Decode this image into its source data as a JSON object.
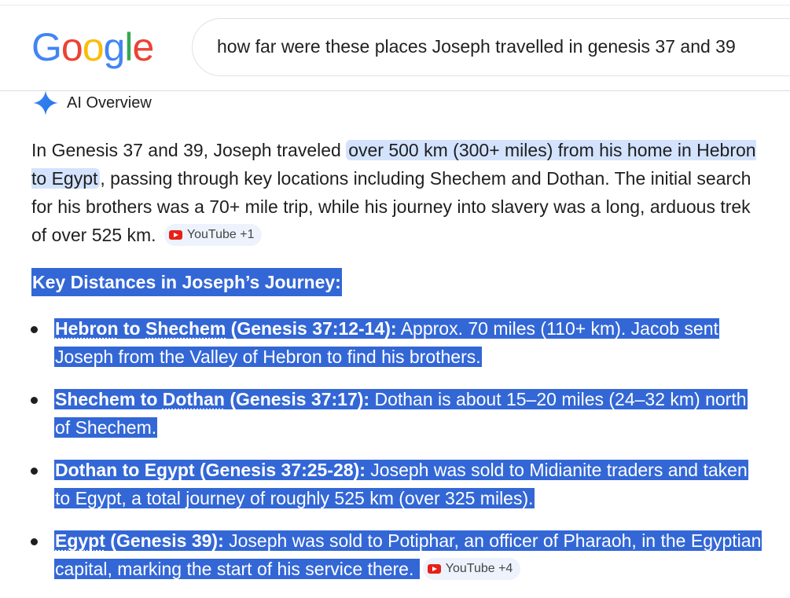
{
  "header": {
    "logo_text": "Google",
    "logo_colors": [
      "#4285F4",
      "#EA4335",
      "#FBBC05",
      "#4285F4",
      "#34A853",
      "#EA4335"
    ],
    "search_query": "how far were these places Joseph travelled in genesis 37 and 39"
  },
  "ai_overview": {
    "title": "AI Overview",
    "icon": "sparkle-icon",
    "intro": {
      "before": "In Genesis 37 and 39, Joseph traveled ",
      "highlight": "over 500 km (300+ miles) from his home in Hebron to Egypt",
      "after": ", passing through key locations including Shechem and Dothan. The initial search for his brothers was a 70+ mile trip, while his journey into slavery was a long, arduous trek of over 525 km. ",
      "source_chip": "YouTube +1"
    },
    "section_heading": "Key Distances in Joseph’s Journey:",
    "items": [
      {
        "place1": "Hebron",
        "connector": " to ",
        "place2": "Shechem",
        "ref": " (Genesis 37:12-14):",
        "text": " Approx. 70 miles (110+ km). Jacob sent Joseph from the Valley of Hebron to find his brothers."
      },
      {
        "place1": "Shechem",
        "connector": " to ",
        "place2": "Dothan",
        "ref": " (Genesis 37:17):",
        "text": " Dothan is about 15–20 miles (24–32 km) north of Shechem."
      },
      {
        "title": "Dothan to Egypt (Genesis 37:25-28):",
        "text": " Joseph was sold to Midianite traders and taken to Egypt, a total journey of roughly 525 km (over 325 miles)."
      },
      {
        "place1": "Egypt",
        "ref": " (Genesis 39):",
        "text": " Joseph was sold to Potiphar, an officer of Pharaoh, in the Egyptian capital, marking the start of his service there. ",
        "source_chip": "YouTube +4"
      }
    ]
  },
  "colors": {
    "selection": "#3367d6",
    "highlight": "#d3e3fd",
    "youtube_red": "#e62117"
  }
}
